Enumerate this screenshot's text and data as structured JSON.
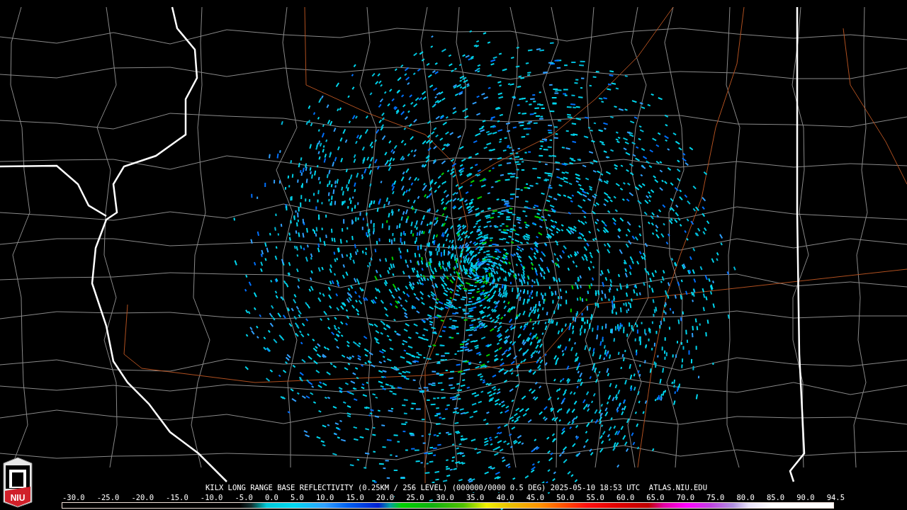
{
  "logo": {
    "text": "NIU"
  },
  "caption": "KILX LONG RANGE BASE REFLECTIVITY (0.25KM / 256 LEVEL) (000000/0000 0.5 DEG) 2025-05-10 18:53 UTC  ATLAS.NIU.EDU",
  "scale_labels": [
    "-30.0",
    "-25.0",
    "-20.0",
    "-15.0",
    "-10.0",
    "-5.0",
    "0.0",
    "5.0",
    "10.0",
    "15.0",
    "20.0",
    "25.0",
    "30.0",
    "35.0",
    "40.0",
    "45.0",
    "50.0",
    "55.0",
    "60.0",
    "65.0",
    "70.0",
    "75.0",
    "80.0",
    "85.0",
    "90.0",
    "94.5"
  ]
}
